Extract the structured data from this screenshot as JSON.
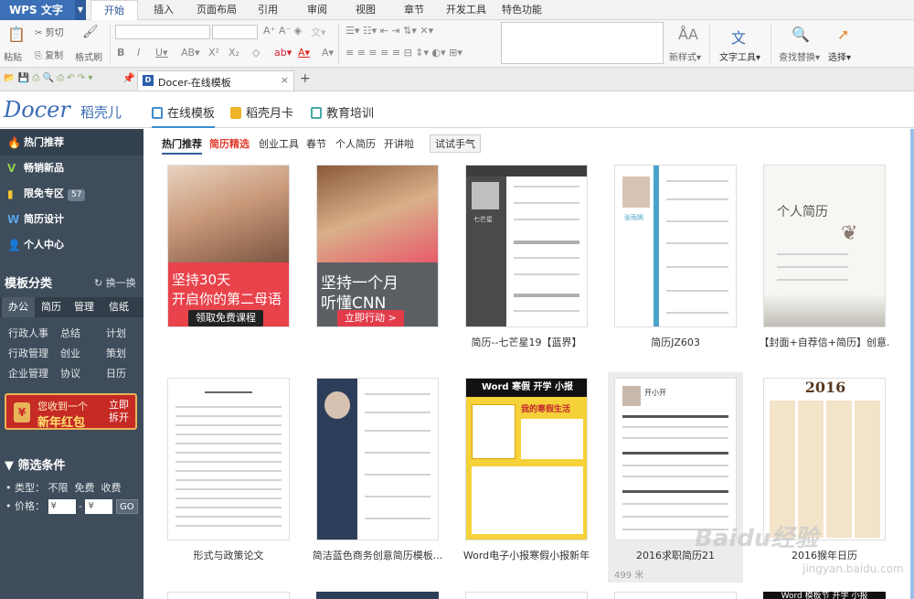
{
  "app": {
    "name": "WPS 文字"
  },
  "menu": {
    "tabs": [
      "开始",
      "插入",
      "页面布局",
      "引用",
      "审阅",
      "视图",
      "章节",
      "开发工具",
      "特色功能"
    ],
    "active": "开始"
  },
  "ribbon": {
    "paste": "粘贴",
    "cut": "剪切",
    "copy": "复制",
    "format_painter": "格式刷",
    "new_style": "新样式",
    "text_tools": "文字工具",
    "find_replace": "查找替换",
    "select": "选择"
  },
  "doc_tab": {
    "title": "Docer-在线模板",
    "add": "+"
  },
  "docer": {
    "logo": "Docer",
    "logo_cn": "稻壳儿",
    "tabs": [
      "在线模板",
      "稻壳月卡",
      "教育培训"
    ]
  },
  "sidebar": {
    "items": [
      {
        "icon": "flame-icon",
        "label": "热门推荐"
      },
      {
        "icon": "v-icon",
        "label": "畅销新品"
      },
      {
        "icon": "tag-icon",
        "label": "限免专区",
        "badge": "57"
      },
      {
        "icon": "w-icon",
        "label": "简历设计"
      },
      {
        "icon": "user-icon",
        "label": "个人中心"
      }
    ],
    "category_title": "模板分类",
    "switch_label": "换一换",
    "cat_tabs": [
      "办公",
      "简历",
      "管理",
      "信纸"
    ],
    "cat_items": [
      "行政人事",
      "总结",
      "计划",
      "行政管理",
      "创业",
      "策划",
      "企业管理",
      "协议",
      "日历"
    ],
    "redpack": {
      "line1": "您收到一个",
      "line2": "新年红包",
      "action": "立即拆开"
    },
    "filter": {
      "title": "筛选条件",
      "type_label": "• 类型：",
      "types": [
        "不限",
        "免费",
        "收费"
      ],
      "price_label": "• 价格：",
      "currency": "¥",
      "dash": "-",
      "go": "GO"
    }
  },
  "main": {
    "subtabs": [
      "热门推荐",
      "简历精选",
      "创业工具",
      "春节",
      "个人简历",
      "开讲啦",
      "试试手气"
    ],
    "cards": [
      {
        "title": "",
        "ad_line1": "坚持30天",
        "ad_line2": "开启你的第二母语",
        "ad_button": "领取免费课程"
      },
      {
        "title": "",
        "ad_line1": "坚持一个月",
        "ad_line2": "听懂CNN",
        "ad_button": "立即行动 >"
      },
      {
        "title": "简历--七芒星19【蓝界】",
        "name_text": "七芒星"
      },
      {
        "title": "简历JZ603",
        "name_text": "张雨嫣"
      },
      {
        "title": "【封面+自荐信+简历】创意.",
        "cover_text": "个人简历"
      },
      {
        "title": "形式与政策论文"
      },
      {
        "title": "简洁蓝色商务创意简历模板..."
      },
      {
        "title": "Word电子小报寒假小报新年",
        "banner": "Word 寒假 开学 小报",
        "sub": "我的寒假生活"
      },
      {
        "title": "2016求职简历21",
        "views": "499 米",
        "name_text": "开小开"
      },
      {
        "title": "2016猴年日历",
        "year": "2016"
      }
    ],
    "bottom_banner": "Word 模板节 开学 小报"
  },
  "watermark": {
    "text": "Baidu经验",
    "sub": "jingyan.baidu.com"
  }
}
